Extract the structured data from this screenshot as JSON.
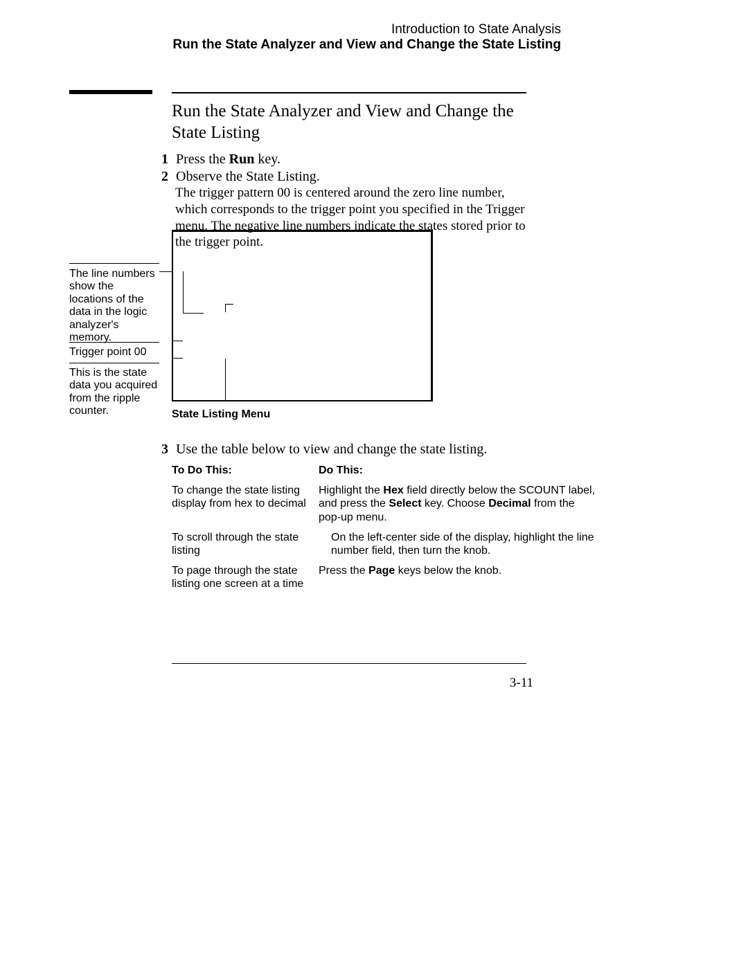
{
  "header": {
    "chapter": "Introduction to State Analysis",
    "section": "Run the State Analyzer and View and Change the State Listing"
  },
  "title": "Run the State Analyzer and View and Change the State Listing",
  "steps": {
    "s1_prefix": "Press the ",
    "s1_bold": "Run",
    "s1_suffix": " key.",
    "s2": "Observe the State Listing.",
    "s2_body": "The trigger pattern 00 is centered around the zero line number, which corresponds to the trigger point you specified in the Trigger menu.  The negative line numbers indicate the states stored prior to the trigger point.",
    "s3": "Use the table below to view and change the state listing."
  },
  "annotations": {
    "a1": "The line numbers show the locations of the data in the logic analyzer's memory.",
    "a2": "Trigger point 00",
    "a3": "This is the state data you acquired from the ripple counter."
  },
  "figure_caption": "State Listing Menu",
  "table": {
    "head1": "To Do This:",
    "head2": "Do This:",
    "rows": [
      {
        "c1": "To change the state listing display from hex to decimal",
        "c2_parts": [
          "Highlight the ",
          "Hex",
          " field directly below the SCOUNT label, and press the ",
          "Select",
          " key.  Choose ",
          "Decimal",
          " from the pop-up menu."
        ]
      },
      {
        "c1": "To scroll through the state listing",
        "c2_parts": [
          "On the left-center side of the display, highlight the line number field, then turn the knob."
        ]
      },
      {
        "c1": "To page through the state listing one screen at a time",
        "c2_parts": [
          "Press the ",
          "Page",
          " keys below the knob."
        ]
      }
    ]
  },
  "page_number": "3-11",
  "nums": {
    "n1": "1",
    "n2": "2",
    "n3": "3"
  }
}
